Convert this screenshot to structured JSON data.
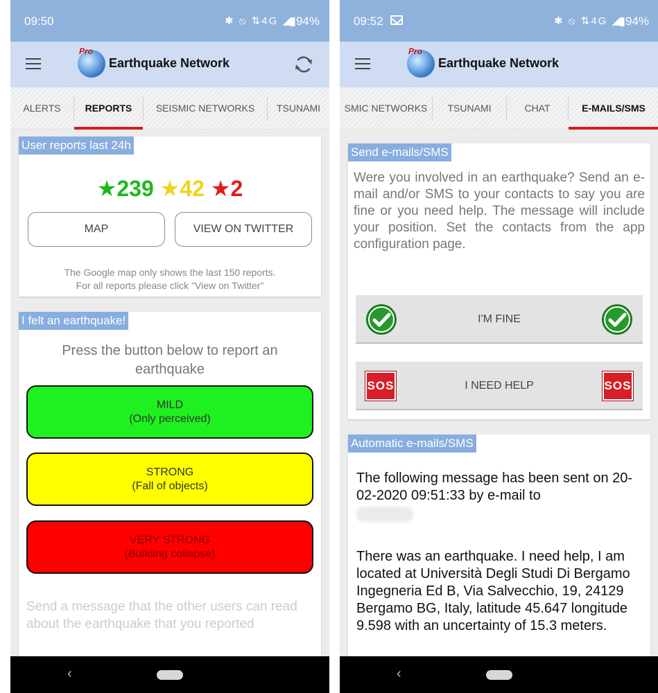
{
  "left": {
    "status": {
      "time": "09:50",
      "icons": "✱ ⦸ ⇅4G ◢",
      "battery": "▮94%"
    },
    "app_title": "Earthquake Network",
    "logo_badge": "Pro",
    "tabs": [
      {
        "label": "ALERTS",
        "active": false
      },
      {
        "label": "REPORTS",
        "active": true
      },
      {
        "label": "SEISMIC NETWORKS",
        "active": false
      },
      {
        "label": "TSUNAMI",
        "active": false
      }
    ],
    "reports_card": {
      "title": "User reports last 24h",
      "star": "★",
      "counts": {
        "green": "239",
        "yellow": "42",
        "red": "2"
      },
      "map_button": "MAP",
      "twitter_button": "VIEW ON TWITTER",
      "note_line1": "The Google map only shows the last 150 reports.",
      "note_line2": "For all reports please click \"View on Twitter\""
    },
    "felt_card": {
      "title": "I felt an earthquake!",
      "instruction": "Press the button below to report an earthquake",
      "mild": {
        "title": "MILD",
        "subtitle": "(Only perceived)"
      },
      "strong": {
        "title": "STRONG",
        "subtitle": "(Fall of objects)"
      },
      "very_strong": {
        "title": "VERY STRONG",
        "subtitle": "(Building collapse)"
      },
      "message_prompt": "Send a message that the other users can read about the earthquake that you reported"
    },
    "nav": {
      "back": "‹"
    }
  },
  "right": {
    "status": {
      "time": "09:52",
      "icons": "✱ ⦸ ⇅4G ◢",
      "battery": "▮94%"
    },
    "app_title": "Earthquake Network",
    "logo_badge": "Pro",
    "tabs": [
      {
        "label": "SMIC NETWORKS",
        "active": false
      },
      {
        "label": "TSUNAMI",
        "active": false
      },
      {
        "label": "CHAT",
        "active": false
      },
      {
        "label": "E-MAILS/SMS",
        "active": true
      }
    ],
    "send_card": {
      "title": "Send e-mails/SMS",
      "description": "Were you involved in an earthquake? Send an e-mail and/or SMS to your contacts to say you are fine or you need help. The message will include your position. Set the contacts from the app configuration page.",
      "im_fine": "I'M FINE",
      "need_help": "I NEED HELP",
      "sos": "SOS"
    },
    "auto_card": {
      "title": "Automatic e-mails/SMS",
      "message1": "The following message has been sent on 20-02-2020 09:51:33 by e-mail to",
      "message2": "There was an earthquake. I need help, I am located at Università Degli Studi Di Bergamo Ingegneria Ed B, Via Salvecchio, 19, 24129 Bergamo BG, Italy, latitude 45.647 longitude 9.598 with an uncertainty of 15.3 meters."
    },
    "nav": {
      "back": "‹"
    }
  },
  "colors": {
    "status_bar": "#8fb2dc",
    "app_bar": "#cfdcf3",
    "card_title_bg": "#88aee0",
    "tab_indicator": "#d41c1c",
    "mild": "#1ff01f",
    "strong": "#ffff00",
    "very_strong": "#ff0000"
  },
  "icons": [
    "menu-icon",
    "logo-icon",
    "refresh-icon",
    "check-icon",
    "sos-icon",
    "mail-icon",
    "back-icon",
    "home-pill"
  ]
}
